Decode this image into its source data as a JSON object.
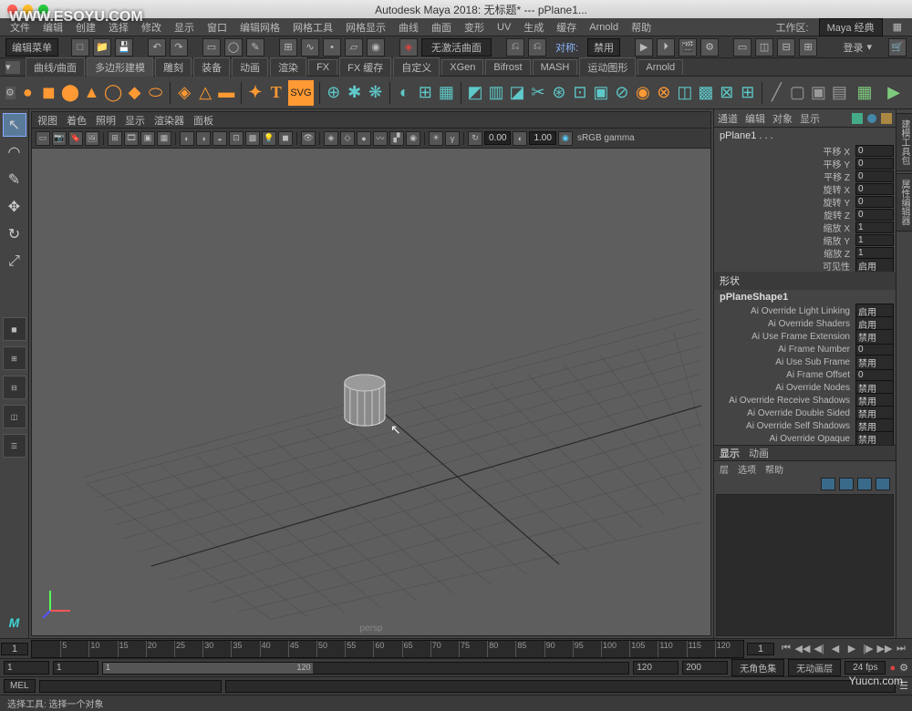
{
  "title": "Autodesk Maya 2018: 无标题*   ---   pPlane1...",
  "watermark": "WWW.ESOYU.COM",
  "watermark_br": "Yuucn.com",
  "menubar": [
    "文件",
    "编辑",
    "创建",
    "选择",
    "修改",
    "显示",
    "窗口",
    "编辑网格",
    "网格工具",
    "网格显示",
    "曲线",
    "曲面",
    "变形",
    "UV",
    "生成",
    "缓存",
    "Arnold",
    "帮助"
  ],
  "workspace_label": "工作区:",
  "workspace_value": "Maya 经典",
  "status": {
    "menu": "编辑菜单",
    "no_active": "无激活曲面",
    "sym_label": "对称:",
    "sym_value": "禁用",
    "login": "登录"
  },
  "shelftabs": [
    "曲线/曲面",
    "多边形建模",
    "雕刻",
    "装备",
    "动画",
    "渲染",
    "FX",
    "FX 缓存",
    "自定义",
    "XGen",
    "Bifrost",
    "MASH",
    "运动图形",
    "Arnold"
  ],
  "shelftabs_active": 1,
  "vptabs": [
    "视图",
    "着色",
    "照明",
    "显示",
    "渲染器",
    "面板"
  ],
  "vpfields": {
    "v1": "0.00",
    "v2": "1.00",
    "gamma": "sRGB gamma"
  },
  "persp": "persp",
  "channel": {
    "tabs": [
      "通道",
      "编辑",
      "对象",
      "显示"
    ],
    "obj": "pPlane1 . . .",
    "attrs": [
      {
        "n": "平移 X",
        "v": "0"
      },
      {
        "n": "平移 Y",
        "v": "0"
      },
      {
        "n": "平移 Z",
        "v": "0"
      },
      {
        "n": "旋转 X",
        "v": "0"
      },
      {
        "n": "旋转 Y",
        "v": "0"
      },
      {
        "n": "旋转 Z",
        "v": "0"
      },
      {
        "n": "缩放 X",
        "v": "1"
      },
      {
        "n": "缩放 Y",
        "v": "1"
      },
      {
        "n": "缩放 Z",
        "v": "1"
      },
      {
        "n": "可见性",
        "v": "启用"
      }
    ],
    "shape_hdr": "形状",
    "shape_name": "pPlaneShape1",
    "shape_attrs": [
      {
        "n": "Ai Override Light Linking",
        "v": "启用"
      },
      {
        "n": "Ai Override Shaders",
        "v": "启用"
      },
      {
        "n": "Ai Use Frame Extension",
        "v": "禁用"
      },
      {
        "n": "Ai Frame Number",
        "v": "0"
      },
      {
        "n": "Ai Use Sub Frame",
        "v": "禁用"
      },
      {
        "n": "Ai Frame Offset",
        "v": "0"
      },
      {
        "n": "Ai Override Nodes",
        "v": "禁用"
      },
      {
        "n": "Ai Override Receive Shadows",
        "v": "禁用"
      },
      {
        "n": "Ai Override Double Sided",
        "v": "禁用"
      },
      {
        "n": "Ai Override Self Shadows",
        "v": "禁用"
      },
      {
        "n": "Ai Override Opaque",
        "v": "禁用"
      }
    ]
  },
  "display": {
    "tabs": [
      "显示",
      "动画"
    ],
    "hdr": [
      "层",
      "选项",
      "帮助"
    ]
  },
  "timeline": {
    "start": "1",
    "ticks": [
      "5",
      "10",
      "15",
      "20",
      "25",
      "30",
      "35",
      "40",
      "45",
      "50",
      "55",
      "60",
      "65",
      "70",
      "75",
      "80",
      "85",
      "90",
      "95",
      "100",
      "105",
      "110",
      "115",
      "120"
    ]
  },
  "range": {
    "f1": "1",
    "f2": "1",
    "f3": "1",
    "f4": "120",
    "f5": "120",
    "f6": "200",
    "charset": "无角色集",
    "layer": "无动画层",
    "fps": "24 fps"
  },
  "cmd": {
    "lang": "MEL"
  },
  "help": "选择工具: 选择一个对象"
}
